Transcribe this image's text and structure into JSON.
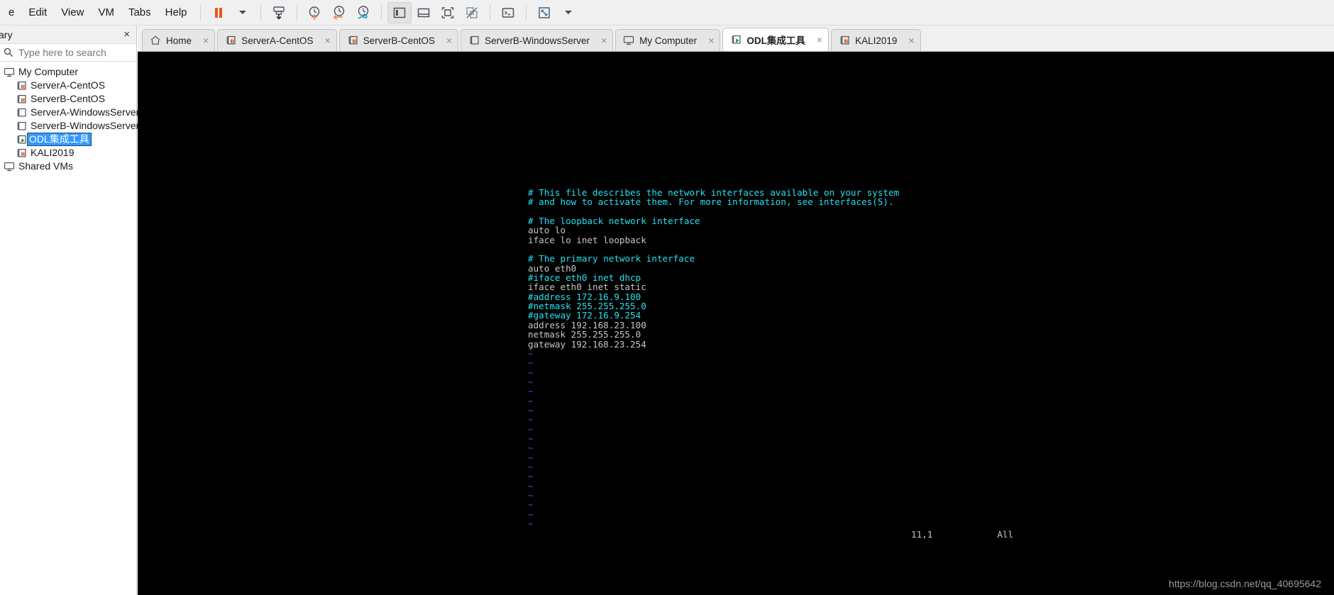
{
  "menubar": {
    "items": [
      {
        "label": "e",
        "accel": "",
        "name": "menu-file"
      },
      {
        "label": "Edit",
        "accel": "E",
        "name": "menu-edit"
      },
      {
        "label": "View",
        "accel": "V",
        "name": "menu-view"
      },
      {
        "label": "VM",
        "accel": "M",
        "name": "menu-vm"
      },
      {
        "label": "Tabs",
        "accel": "T",
        "name": "menu-tabs"
      },
      {
        "label": "Help",
        "accel": "H",
        "name": "menu-help"
      }
    ],
    "toolbar": [
      {
        "name": "suspend-button",
        "icon": "pause-icon",
        "color": "#e8581c"
      },
      {
        "name": "power-dropdown-button",
        "icon": "chevron-down-icon"
      },
      {
        "name": "send-ctrl-alt-del-button",
        "icon": "snapshot-take-icon"
      },
      {
        "name": "take-snapshot-button",
        "icon": "snapshot-clock-plus-icon"
      },
      {
        "name": "revert-snapshot-button",
        "icon": "snapshot-clock-back-icon"
      },
      {
        "name": "snapshot-manager-button",
        "icon": "snapshot-clock-wrench-icon"
      },
      {
        "name": "show-library-button",
        "icon": "panel-left-icon"
      },
      {
        "name": "show-thumbnail-bar-button",
        "icon": "panel-bottom-icon"
      },
      {
        "name": "show-console-view-button",
        "icon": "fullscreen-icon"
      },
      {
        "name": "unity-mode-button",
        "icon": "unity-disabled-icon"
      },
      {
        "name": "console-button",
        "icon": "terminal-icon"
      },
      {
        "name": "fullscreen-button",
        "icon": "expand-arrows-icon"
      },
      {
        "name": "fullscreen-dropdown-button",
        "icon": "chevron-down-icon"
      }
    ]
  },
  "sidebar": {
    "title": "ary",
    "close_label": "×",
    "search": {
      "placeholder": "Type here to search",
      "value": "",
      "icon": "search-icon",
      "dropdown_icon": "chevron-down-icon"
    },
    "tree": [
      {
        "label": "My Computer",
        "level": 0,
        "icon": "computer-icon",
        "selected": false,
        "name": "tree-item-my-computer"
      },
      {
        "label": "ServerA-CentOS",
        "level": 1,
        "icon": "vm-running-icon",
        "selected": false,
        "name": "tree-item-servera-centos"
      },
      {
        "label": "ServerB-CentOS",
        "level": 1,
        "icon": "vm-running-icon",
        "selected": false,
        "name": "tree-item-serverb-centos"
      },
      {
        "label": "ServerA-WindowsServer",
        "level": 1,
        "icon": "vm-powered-off-icon",
        "selected": false,
        "name": "tree-item-servera-windowsserver"
      },
      {
        "label": "ServerB-WindowsServer",
        "level": 1,
        "icon": "vm-powered-off-icon",
        "selected": false,
        "name": "tree-item-serverb-windowsserver"
      },
      {
        "label": "ODL集成工具",
        "level": 1,
        "icon": "vm-playing-icon",
        "selected": true,
        "name": "tree-item-odl"
      },
      {
        "label": "KALI2019",
        "level": 1,
        "icon": "vm-running-icon",
        "selected": false,
        "name": "tree-item-kali2019"
      },
      {
        "label": "Shared VMs",
        "level": 0,
        "icon": "shared-vms-icon",
        "selected": false,
        "name": "tree-item-shared-vms"
      }
    ]
  },
  "tabbar": {
    "close_label": "×",
    "tabs": [
      {
        "label": "Home",
        "icon": "home-icon",
        "active": false,
        "name": "tab-home"
      },
      {
        "label": "ServerA-CentOS",
        "icon": "vm-running-icon",
        "active": false,
        "name": "tab-servera-centos"
      },
      {
        "label": "ServerB-CentOS",
        "icon": "vm-running-icon",
        "active": false,
        "name": "tab-serverb-centos"
      },
      {
        "label": "ServerB-WindowsServer",
        "icon": "vm-powered-off-icon",
        "active": false,
        "name": "tab-serverb-windowsserver"
      },
      {
        "label": "My Computer",
        "icon": "computer-icon",
        "active": false,
        "name": "tab-my-computer"
      },
      {
        "label": "ODL集成工具",
        "icon": "vm-playing-icon",
        "active": true,
        "name": "tab-odl"
      },
      {
        "label": "KALI2019",
        "icon": "vm-running-icon",
        "active": false,
        "name": "tab-kali2019"
      }
    ]
  },
  "terminal": {
    "colors": {
      "background": "#000000",
      "comment": "#22e2f0",
      "text": "#c6c6c6",
      "tilde": "#4a4ae8"
    },
    "lines": [
      {
        "kind": "comment",
        "text": "# This file describes the network interfaces available on your system"
      },
      {
        "kind": "comment",
        "text": "# and how to activate them. For more information, see interfaces(5)."
      },
      {
        "kind": "text",
        "text": ""
      },
      {
        "kind": "comment",
        "text": "# The loopback network interface"
      },
      {
        "kind": "text",
        "text": "auto lo"
      },
      {
        "kind": "text",
        "text": "iface lo inet loopback"
      },
      {
        "kind": "text",
        "text": ""
      },
      {
        "kind": "comment",
        "text": "# The primary network interface"
      },
      {
        "kind": "text",
        "text": "auto eth0"
      },
      {
        "kind": "comment",
        "text": "#iface eth0 inet dhcp"
      },
      {
        "kind": "text",
        "text": "iface eth0 inet static"
      },
      {
        "kind": "comment",
        "text": "#address 172.16.9.100"
      },
      {
        "kind": "comment",
        "text": "#netmask 255.255.255.0"
      },
      {
        "kind": "comment",
        "text": "#gateway 172.16.9.254"
      },
      {
        "kind": "text",
        "text": "address 192.168.23.100"
      },
      {
        "kind": "text",
        "text": "netmask 255.255.255.0"
      },
      {
        "kind": "text",
        "text": "gateway 192.168.23.254"
      },
      {
        "kind": "tilde",
        "text": "~"
      },
      {
        "kind": "tilde",
        "text": "~"
      },
      {
        "kind": "tilde",
        "text": "~"
      },
      {
        "kind": "tilde",
        "text": "~"
      },
      {
        "kind": "tilde",
        "text": "~"
      },
      {
        "kind": "tilde",
        "text": "~"
      },
      {
        "kind": "tilde",
        "text": "~"
      },
      {
        "kind": "tilde",
        "text": "~"
      },
      {
        "kind": "tilde",
        "text": "~"
      },
      {
        "kind": "tilde",
        "text": "~"
      },
      {
        "kind": "tilde",
        "text": "~"
      },
      {
        "kind": "tilde",
        "text": "~"
      },
      {
        "kind": "tilde",
        "text": "~"
      },
      {
        "kind": "tilde",
        "text": "~"
      },
      {
        "kind": "tilde",
        "text": "~"
      },
      {
        "kind": "tilde",
        "text": "~"
      },
      {
        "kind": "tilde",
        "text": "~"
      },
      {
        "kind": "tilde",
        "text": "~"
      },
      {
        "kind": "tilde",
        "text": "~"
      }
    ],
    "status": {
      "cursor_position": "11,1",
      "scroll_position": "All"
    }
  },
  "watermark": "https://blog.csdn.net/qq_40695642"
}
